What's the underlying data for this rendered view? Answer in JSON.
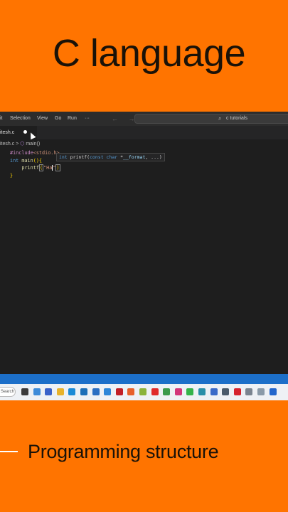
{
  "overlay": {
    "title": "C language",
    "subtitle": "Programming structure"
  },
  "menubar": {
    "items": [
      "it",
      "Selection",
      "View",
      "Go",
      "Run",
      "···"
    ],
    "nav_arrows": "← →",
    "search_icon": "⌕",
    "search_text": "c tutorials"
  },
  "tab": {
    "filename": "itesh.c"
  },
  "breadcrumb": {
    "file": "itesh.c",
    "separator": ">",
    "cube_icon": "⬡",
    "symbol": "main()"
  },
  "editor": {
    "line1_pre": "#include",
    "line1_hdr": "<stdio.",
    "line1_tail": "h>",
    "line2_kw": "int",
    "line2_fn": " main",
    "line2_br": "(){",
    "line3_indent": "    ",
    "line3_fn": "printf",
    "line3_br_open": "(",
    "line3_str": "\"Ha",
    "line3_str_end": "\"",
    "line3_br_close": ")",
    "line4_br": "}"
  },
  "hint": {
    "kw_int": "int",
    "fn": " printf(",
    "kw_const": "const",
    "kw_char": " char",
    "star": " *",
    "param": "__format",
    "rest": ", ...)"
  },
  "taskbar": {
    "search_label": "Search",
    "icons": [
      {
        "name": "file-explorer-icon",
        "color": "#3b3b3b"
      },
      {
        "name": "weather-icon",
        "color": "#3d8bd9"
      },
      {
        "name": "chat-icon",
        "color": "#3a62c9"
      },
      {
        "name": "folder-icon",
        "color": "#e8b22a"
      },
      {
        "name": "edge-icon",
        "color": "#1b8ad6"
      },
      {
        "name": "vscode-icon",
        "color": "#1d6fb8"
      },
      {
        "name": "store-icon",
        "color": "#2b6fc2"
      },
      {
        "name": "mail-icon",
        "color": "#2d86d8"
      },
      {
        "name": "mcafee-icon",
        "color": "#c21e25"
      },
      {
        "name": "firefox-icon",
        "color": "#e8602a"
      },
      {
        "name": "notes-icon",
        "color": "#8bb33a"
      },
      {
        "name": "youtube-icon",
        "color": "#e02a2a"
      },
      {
        "name": "chrome-icon",
        "color": "#3c9a4b"
      },
      {
        "name": "instagram-icon",
        "color": "#d3357a"
      },
      {
        "name": "whatsapp-icon",
        "color": "#35b34a"
      },
      {
        "name": "app-teal-icon",
        "color": "#2a8fa8"
      },
      {
        "name": "app-blue-icon",
        "color": "#3a6ac8"
      },
      {
        "name": "camera-icon",
        "color": "#4a5a6a"
      },
      {
        "name": "opera-icon",
        "color": "#d6232e"
      },
      {
        "name": "app-grey-icon",
        "color": "#7a8490"
      },
      {
        "name": "pin-icon",
        "color": "#8a9aa8"
      },
      {
        "name": "app-blue2-icon",
        "color": "#2266cc"
      }
    ]
  }
}
